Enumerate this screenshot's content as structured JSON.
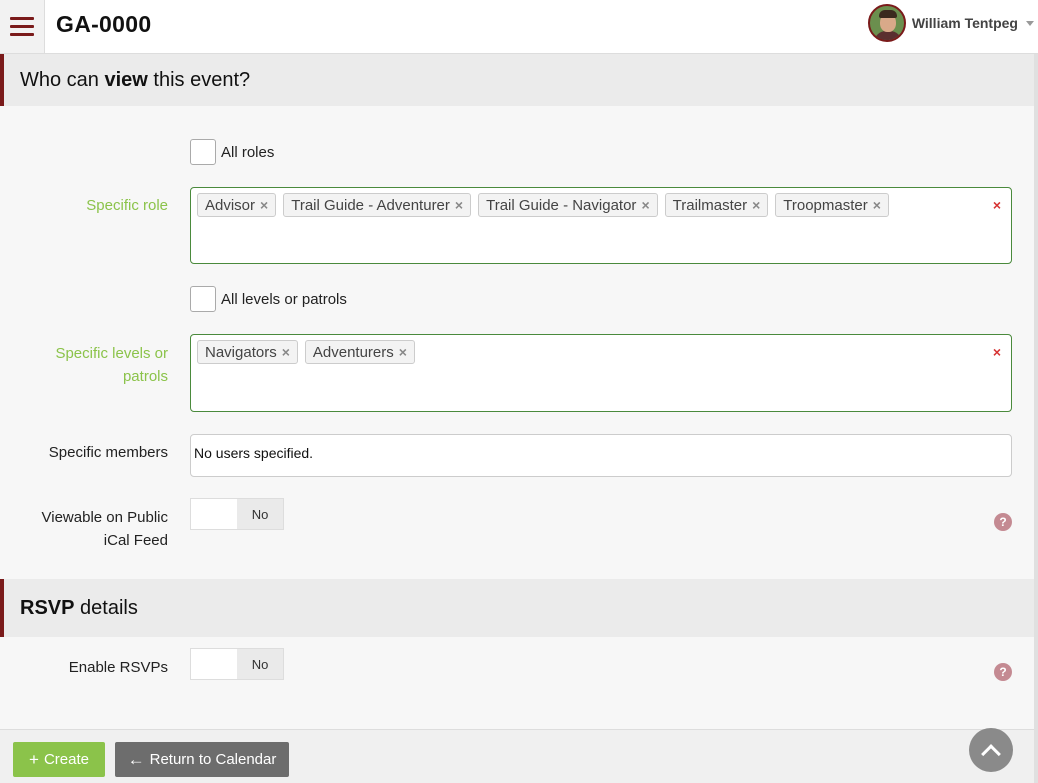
{
  "header": {
    "app_title": "GA-0000",
    "user_name": "William Tentpeg"
  },
  "view_section": {
    "title_before": "Who can ",
    "title_bold": "view",
    "title_after": " this event?",
    "all_roles_label": "All roles",
    "specific_role_label": "Specific role",
    "specific_roles": [
      "Advisor",
      "Trail Guide - Adventurer",
      "Trail Guide - Navigator",
      "Trailmaster",
      "Troopmaster"
    ],
    "all_levels_label": "All levels or patrols",
    "specific_levels_label_line1": "Specific levels or",
    "specific_levels_label_line2": "patrols",
    "specific_levels": [
      "Navigators",
      "Adventurers"
    ],
    "specific_members_label": "Specific members",
    "specific_members_value": "No users specified.",
    "ical_label_line1": "Viewable on Public",
    "ical_label_line2": "iCal Feed",
    "ical_toggle_value": "No"
  },
  "rsvp_section": {
    "title_bold": "RSVP",
    "title_after": " details",
    "enable_rsvps_label": "Enable RSVPs",
    "enable_rsvps_value": "No"
  },
  "footer": {
    "create_label": "Create",
    "return_label": "Return to Calendar"
  },
  "icons": {
    "remove_tag": "×",
    "clear": "×",
    "help": "?",
    "plus": "+",
    "arrow_left": "←"
  },
  "colors": {
    "accent": "#7a1a1a",
    "green": "#8bc34a",
    "clear_red": "#d63333"
  }
}
